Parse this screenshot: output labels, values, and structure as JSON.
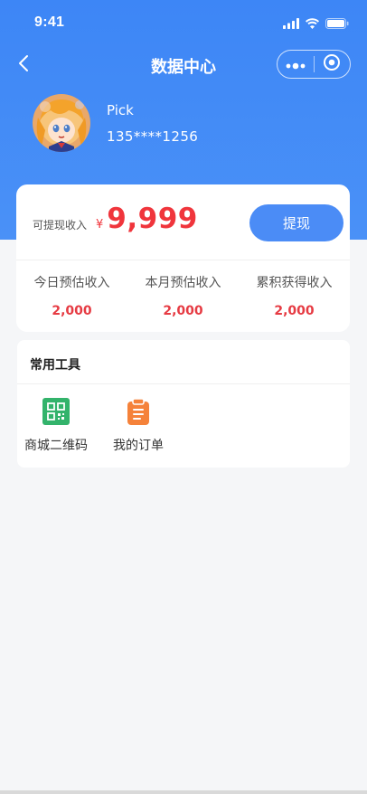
{
  "status_bar": {
    "time": "9:41",
    "icons": [
      "signal-icon",
      "wifi-icon",
      "battery-icon"
    ]
  },
  "nav": {
    "title": "数据中心",
    "back_icon": "chevron-left-icon",
    "capsule_icons": [
      "more-dots-icon",
      "record-target-icon"
    ]
  },
  "profile": {
    "name": "Pick",
    "phone": "135****1256",
    "avatar_icon": "user-avatar-illustration"
  },
  "income": {
    "withdraw_label": "可提现收入",
    "currency": "¥",
    "amount": "9,999",
    "withdraw_button": "提现",
    "stats": [
      {
        "label": "今日预估收入",
        "value": "2,000"
      },
      {
        "label": "本月预估收入",
        "value": "2,000"
      },
      {
        "label": "累积获得收入",
        "value": "2,000"
      }
    ]
  },
  "tools": {
    "title": "常用工具",
    "items": [
      {
        "label": "商城二维码",
        "icon": "qr-code-icon",
        "color": "#33b36b"
      },
      {
        "label": "我的订单",
        "icon": "clipboard-icon",
        "color": "#f5823a"
      }
    ]
  },
  "colors": {
    "header_blue": "#3d86f6",
    "accent_red": "#f0353c",
    "button_blue": "#4b8cf6",
    "background": "#f5f6f8"
  }
}
